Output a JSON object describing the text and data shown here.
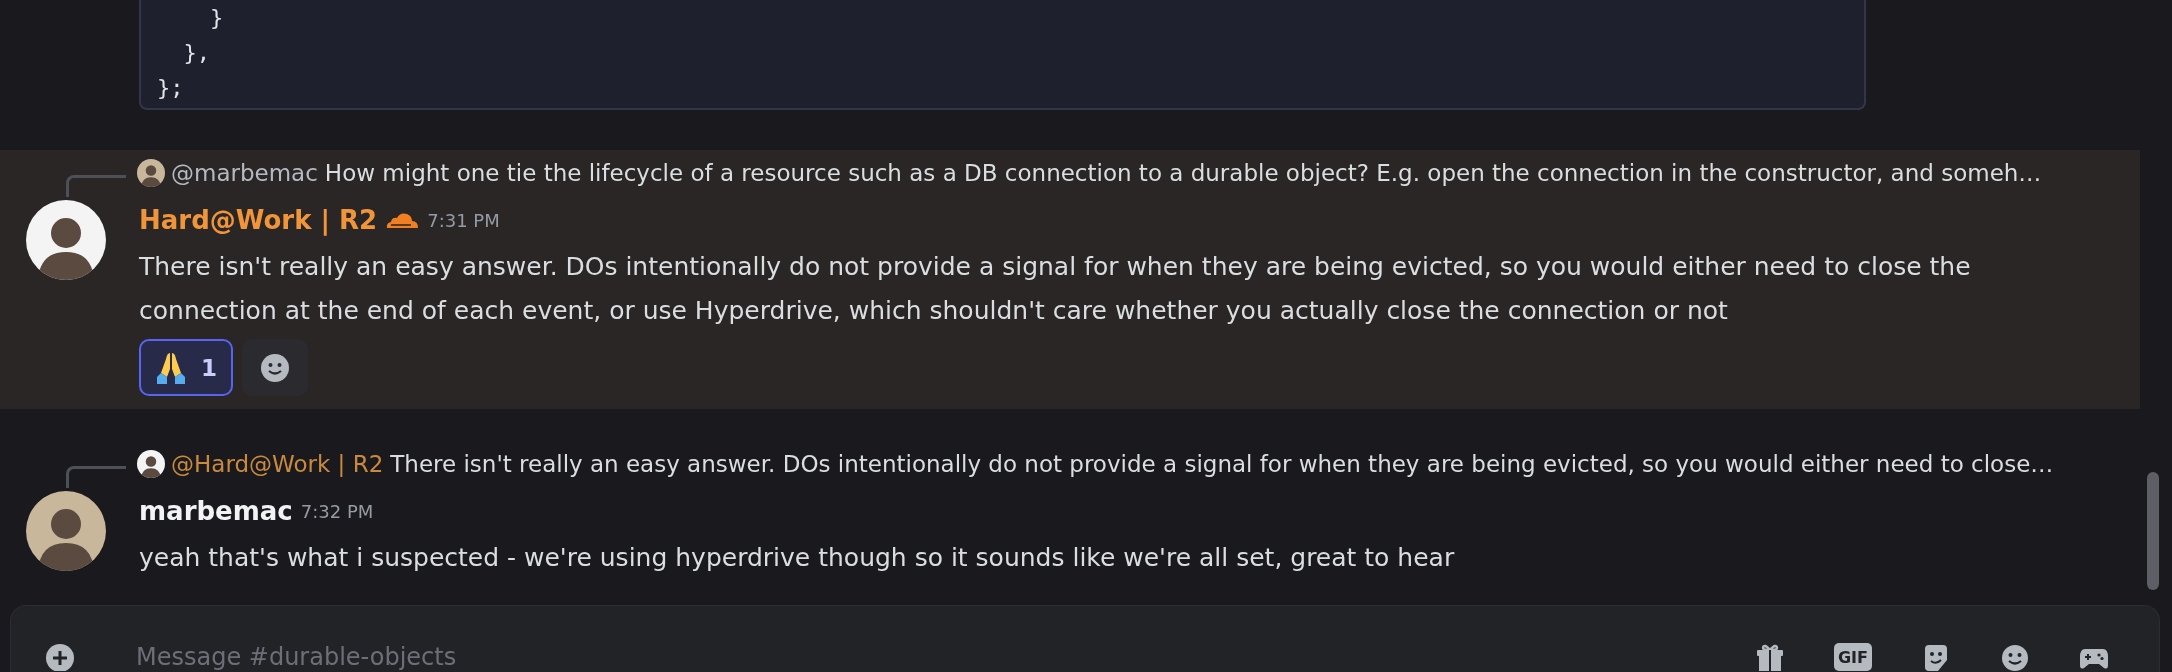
{
  "code_block": {
    "lines": [
      "    }",
      "  },",
      "};"
    ]
  },
  "messages": [
    {
      "highlighted": true,
      "reply": {
        "avatar": {
          "color": "#c9b79c"
        },
        "mention": "@marbemac",
        "color": "#b5bac1",
        "text": "How might one tie the lifecycle of a resource such as a DB connection to a durable object? E.g. open the connection in the constructor, and someh…"
      },
      "avatar": {
        "color": "#f4f4f4"
      },
      "author": {
        "name": "Hard@Work | R2",
        "color": "#f0953a",
        "role_icon": true
      },
      "time": "7:31 PM",
      "text": "There isn't really an easy answer. DOs intentionally do not provide a signal for when they are being evicted, so you would either need to close the connection at the end of each event, or use Hyperdrive, which shouldn't care whether you actually close the connection or not",
      "reactions": [
        {
          "count": "1",
          "selected": true
        }
      ]
    },
    {
      "highlighted": false,
      "reply": {
        "avatar": {
          "color": "#f4f4f4"
        },
        "mention": "@Hard@Work | R2",
        "color": "#c98a3e",
        "text": "There isn't really an easy answer. DOs intentionally do not provide a signal for when they are being evicted, so you would either need to close…"
      },
      "avatar": {
        "color": "#c9b79c"
      },
      "author": {
        "name": "marbemac",
        "color": "#f2f3f5",
        "role_icon": false
      },
      "time": "7:32 PM",
      "text": "yeah that's what i suspected - we're using hyperdrive though so it sounds like we're all set, great to hear"
    }
  ],
  "composer": {
    "placeholder": "Message #durable-objects",
    "gif_label": "GIF"
  }
}
